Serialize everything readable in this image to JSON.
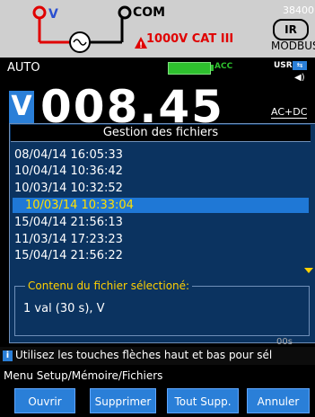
{
  "header": {
    "v_label": "V",
    "com_label": "COM",
    "cat_label": "1000V CAT III",
    "top_right": "38400",
    "ir_label": "IR",
    "modbus_label": "MODBUS"
  },
  "status": {
    "mode": "AUTO",
    "acc_label": "ACC",
    "usr_label": "USR"
  },
  "reading": {
    "unit_badge": "V",
    "value": "008.45",
    "coupling": "AC+DC"
  },
  "dialog": {
    "title": "Gestion des fichiers",
    "files": [
      "08/04/14 16:05:33",
      "10/04/14 10:36:42",
      "10/03/14 10:32:52",
      "10/03/14 10:33:04",
      "15/04/14 21:56:13",
      "11/03/14 17:23:23",
      "15/04/14 21:56:22"
    ],
    "selected_index": 3,
    "content_legend": "Contenu du fichier sélectioné:",
    "content_value": "1 val (30 s), V"
  },
  "under_text": "00s",
  "help": {
    "text": "Utilisez les touches flèches haut et bas pour sél"
  },
  "menu_path": "Menu Setup/Mémoire/Fichiers",
  "buttons": {
    "open": "Ouvrir",
    "delete": "Supprimer",
    "delete_all": "Tout Supp.",
    "cancel": "Annuler"
  },
  "colors": {
    "accent": "#2a7fd8",
    "dialog_bg": "#0b3360",
    "highlight_text": "#ffe000",
    "legend": "#ffd000",
    "warning": "#e00000",
    "battery": "#2ec02e"
  }
}
